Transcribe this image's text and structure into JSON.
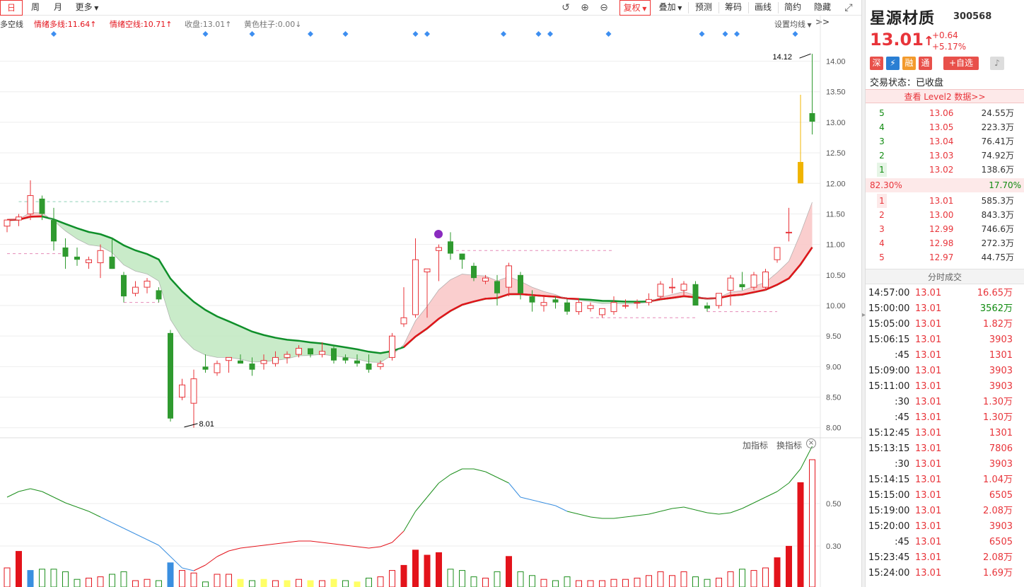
{
  "toolbar": {
    "period_day": "日",
    "period_week": "周",
    "period_month": "月",
    "more": "更多",
    "fuquan": "复权",
    "overlay": "叠加",
    "forecast": "预测",
    "chips": "筹码",
    "draw": "画线",
    "simple": "简约",
    "hide": "隐藏>>"
  },
  "legend": {
    "label": "多空线",
    "bull": "情绪多线:11.64",
    "bear": "情绪空线:10.71",
    "close": "收盘:13.01",
    "yellow": "黄色柱子:0.00",
    "settings": "设置均线"
  },
  "annotations": {
    "high": "14.12",
    "low": "8.01"
  },
  "price_axis": [
    "14.00",
    "13.50",
    "13.00",
    "12.50",
    "12.00",
    "11.50",
    "11.00",
    "10.50",
    "10.00",
    "9.50",
    "9.00",
    "8.50",
    "8.00"
  ],
  "indicator": {
    "add": "加指标",
    "switch": "换指标",
    "ticks": [
      "0.50",
      "0.30"
    ]
  },
  "colors": {
    "up": "#e8343a",
    "down": "#2f9a2f",
    "bull_line": "#0f8f2a",
    "bear_line": "#e3131b",
    "diamond": "#3d8ef0"
  },
  "chart_data": {
    "type": "candlestick",
    "ylim": [
      7.8,
      14.4
    ],
    "candles": [
      [
        11.3,
        11.4,
        11.2,
        11.4
      ],
      [
        11.4,
        11.5,
        11.3,
        11.45
      ],
      [
        11.5,
        12.05,
        11.4,
        11.8
      ],
      [
        11.75,
        11.8,
        11.4,
        11.5
      ],
      [
        11.4,
        11.6,
        10.9,
        11.05
      ],
      [
        10.95,
        11.1,
        10.6,
        10.8
      ],
      [
        10.8,
        10.95,
        10.65,
        10.75
      ],
      [
        10.7,
        10.8,
        10.6,
        10.75
      ],
      [
        10.7,
        11.0,
        10.45,
        10.9
      ],
      [
        10.8,
        11.1,
        10.6,
        10.6
      ],
      [
        10.5,
        10.55,
        10.05,
        10.15
      ],
      [
        10.2,
        10.4,
        10.15,
        10.3
      ],
      [
        10.3,
        10.45,
        10.2,
        10.4
      ],
      [
        10.25,
        10.3,
        10.05,
        10.1
      ],
      [
        9.55,
        9.6,
        8.1,
        8.15
      ],
      [
        8.5,
        8.8,
        8.45,
        8.7
      ],
      [
        8.4,
        8.95,
        8.0,
        8.8
      ],
      [
        9.0,
        9.2,
        8.9,
        8.95
      ],
      [
        8.9,
        9.1,
        8.85,
        9.05
      ],
      [
        9.1,
        9.15,
        8.9,
        9.15
      ],
      [
        9.1,
        9.2,
        9.1,
        9.05
      ],
      [
        9.05,
        9.15,
        8.85,
        8.95
      ],
      [
        9.05,
        9.2,
        8.95,
        9.1
      ],
      [
        9.05,
        9.25,
        9.0,
        9.15
      ],
      [
        9.15,
        9.25,
        9.05,
        9.2
      ],
      [
        9.2,
        9.35,
        9.15,
        9.3
      ],
      [
        9.3,
        9.3,
        9.15,
        9.2
      ],
      [
        9.2,
        9.4,
        9.15,
        9.25
      ],
      [
        9.3,
        9.35,
        9.05,
        9.1
      ],
      [
        9.15,
        9.2,
        9.05,
        9.1
      ],
      [
        9.1,
        9.2,
        9.0,
        9.05
      ],
      [
        9.05,
        9.2,
        8.9,
        8.95
      ],
      [
        9.0,
        9.1,
        8.95,
        9.05
      ],
      [
        9.15,
        9.55,
        9.1,
        9.5
      ],
      [
        9.7,
        10.3,
        9.65,
        9.8
      ],
      [
        9.85,
        11.1,
        9.8,
        10.75
      ],
      [
        10.55,
        10.6,
        9.8,
        10.6
      ],
      [
        10.9,
        11.0,
        10.4,
        10.95
      ],
      [
        11.05,
        11.2,
        10.75,
        10.85
      ],
      [
        10.85,
        10.85,
        10.6,
        10.75
      ],
      [
        10.65,
        10.7,
        10.4,
        10.45
      ],
      [
        10.4,
        10.5,
        10.35,
        10.45
      ],
      [
        10.4,
        10.5,
        10.0,
        10.2
      ],
      [
        10.3,
        10.7,
        10.15,
        10.65
      ],
      [
        10.5,
        10.55,
        10.1,
        10.2
      ],
      [
        10.15,
        10.25,
        9.9,
        10.05
      ],
      [
        10.0,
        10.15,
        9.9,
        10.05
      ],
      [
        10.1,
        10.15,
        9.95,
        10.05
      ],
      [
        10.05,
        10.1,
        9.85,
        9.9
      ],
      [
        9.9,
        10.1,
        9.85,
        10.05
      ],
      [
        9.95,
        10.05,
        9.9,
        10.0
      ],
      [
        9.85,
        9.9,
        9.8,
        9.95
      ],
      [
        9.9,
        10.15,
        9.85,
        10.05
      ],
      [
        10.0,
        10.1,
        9.95,
        10.0
      ],
      [
        10.05,
        10.1,
        9.95,
        10.05
      ],
      [
        10.05,
        10.2,
        10.0,
        10.1
      ],
      [
        10.15,
        10.4,
        10.1,
        10.35
      ],
      [
        10.3,
        10.45,
        10.2,
        10.3
      ],
      [
        10.25,
        10.4,
        10.15,
        10.35
      ],
      [
        10.35,
        10.4,
        10.0,
        10.0
      ],
      [
        10.0,
        10.05,
        9.9,
        9.95
      ],
      [
        10.0,
        10.2,
        9.95,
        10.2
      ],
      [
        10.25,
        10.5,
        10.0,
        10.45
      ],
      [
        10.35,
        10.55,
        10.25,
        10.3
      ],
      [
        10.3,
        10.55,
        10.25,
        10.5
      ],
      [
        10.3,
        10.6,
        10.25,
        10.55
      ],
      [
        10.75,
        10.95,
        10.7,
        10.95
      ],
      [
        11.2,
        11.6,
        11.05,
        11.2
      ],
      [
        12.0,
        13.45,
        12.0,
        12.35
      ],
      [
        13.15,
        14.12,
        12.8,
        13.01
      ]
    ]
  },
  "right": {
    "name": "星源材质",
    "code": "300568",
    "price": "13.01",
    "arrow": "↑",
    "change_abs": "+0.64",
    "change_pct": "+5.17%",
    "tags": [
      "深",
      "⚡",
      "融",
      "通"
    ],
    "watch": "+自选",
    "status": "交易状态：已收盘",
    "level2": "查看 Level2 数据>>",
    "sells": [
      {
        "lvl": "5",
        "price": "13.06",
        "vol": "24.55万"
      },
      {
        "lvl": "4",
        "price": "13.05",
        "vol": "223.3万"
      },
      {
        "lvl": "3",
        "price": "13.04",
        "vol": "76.41万"
      },
      {
        "lvl": "2",
        "price": "13.03",
        "vol": "74.92万"
      },
      {
        "lvl": "1",
        "price": "13.02",
        "vol": "138.6万"
      }
    ],
    "ratio_left": "82.30%",
    "ratio_right": "17.70%",
    "buys": [
      {
        "lvl": "1",
        "price": "13.01",
        "vol": "585.3万"
      },
      {
        "lvl": "2",
        "price": "13.00",
        "vol": "843.3万"
      },
      {
        "lvl": "3",
        "price": "12.99",
        "vol": "746.6万"
      },
      {
        "lvl": "4",
        "price": "12.98",
        "vol": "272.3万"
      },
      {
        "lvl": "5",
        "price": "12.97",
        "vol": "44.75万"
      }
    ],
    "trades_title": "分时成交",
    "trades": [
      {
        "t": "14:57:00",
        "p": "13.01",
        "v": "16.65万",
        "c": "red"
      },
      {
        "t": "15:00:00",
        "p": "13.01",
        "v": "3562万",
        "c": "green"
      },
      {
        "t": "15:05:00",
        "p": "13.01",
        "v": "1.82万",
        "c": "red"
      },
      {
        "t": "15:06:15",
        "p": "13.01",
        "v": "3903",
        "c": "red"
      },
      {
        "t": ":45",
        "p": "13.01",
        "v": "1301",
        "c": "red"
      },
      {
        "t": "15:09:00",
        "p": "13.01",
        "v": "3903",
        "c": "red"
      },
      {
        "t": "15:11:00",
        "p": "13.01",
        "v": "3903",
        "c": "red"
      },
      {
        "t": ":30",
        "p": "13.01",
        "v": "1.30万",
        "c": "red"
      },
      {
        "t": ":45",
        "p": "13.01",
        "v": "1.30万",
        "c": "red"
      },
      {
        "t": "15:12:45",
        "p": "13.01",
        "v": "1301",
        "c": "red"
      },
      {
        "t": "15:13:15",
        "p": "13.01",
        "v": "7806",
        "c": "red"
      },
      {
        "t": ":30",
        "p": "13.01",
        "v": "3903",
        "c": "red"
      },
      {
        "t": "15:14:15",
        "p": "13.01",
        "v": "1.04万",
        "c": "red"
      },
      {
        "t": "15:15:00",
        "p": "13.01",
        "v": "6505",
        "c": "red"
      },
      {
        "t": "15:19:00",
        "p": "13.01",
        "v": "2.08万",
        "c": "red"
      },
      {
        "t": "15:20:00",
        "p": "13.01",
        "v": "3903",
        "c": "red"
      },
      {
        "t": ":45",
        "p": "13.01",
        "v": "6505",
        "c": "red"
      },
      {
        "t": "15:23:45",
        "p": "13.01",
        "v": "2.08万",
        "c": "red"
      },
      {
        "t": "15:24:00",
        "p": "13.01",
        "v": "1.69万",
        "c": "red"
      }
    ]
  }
}
